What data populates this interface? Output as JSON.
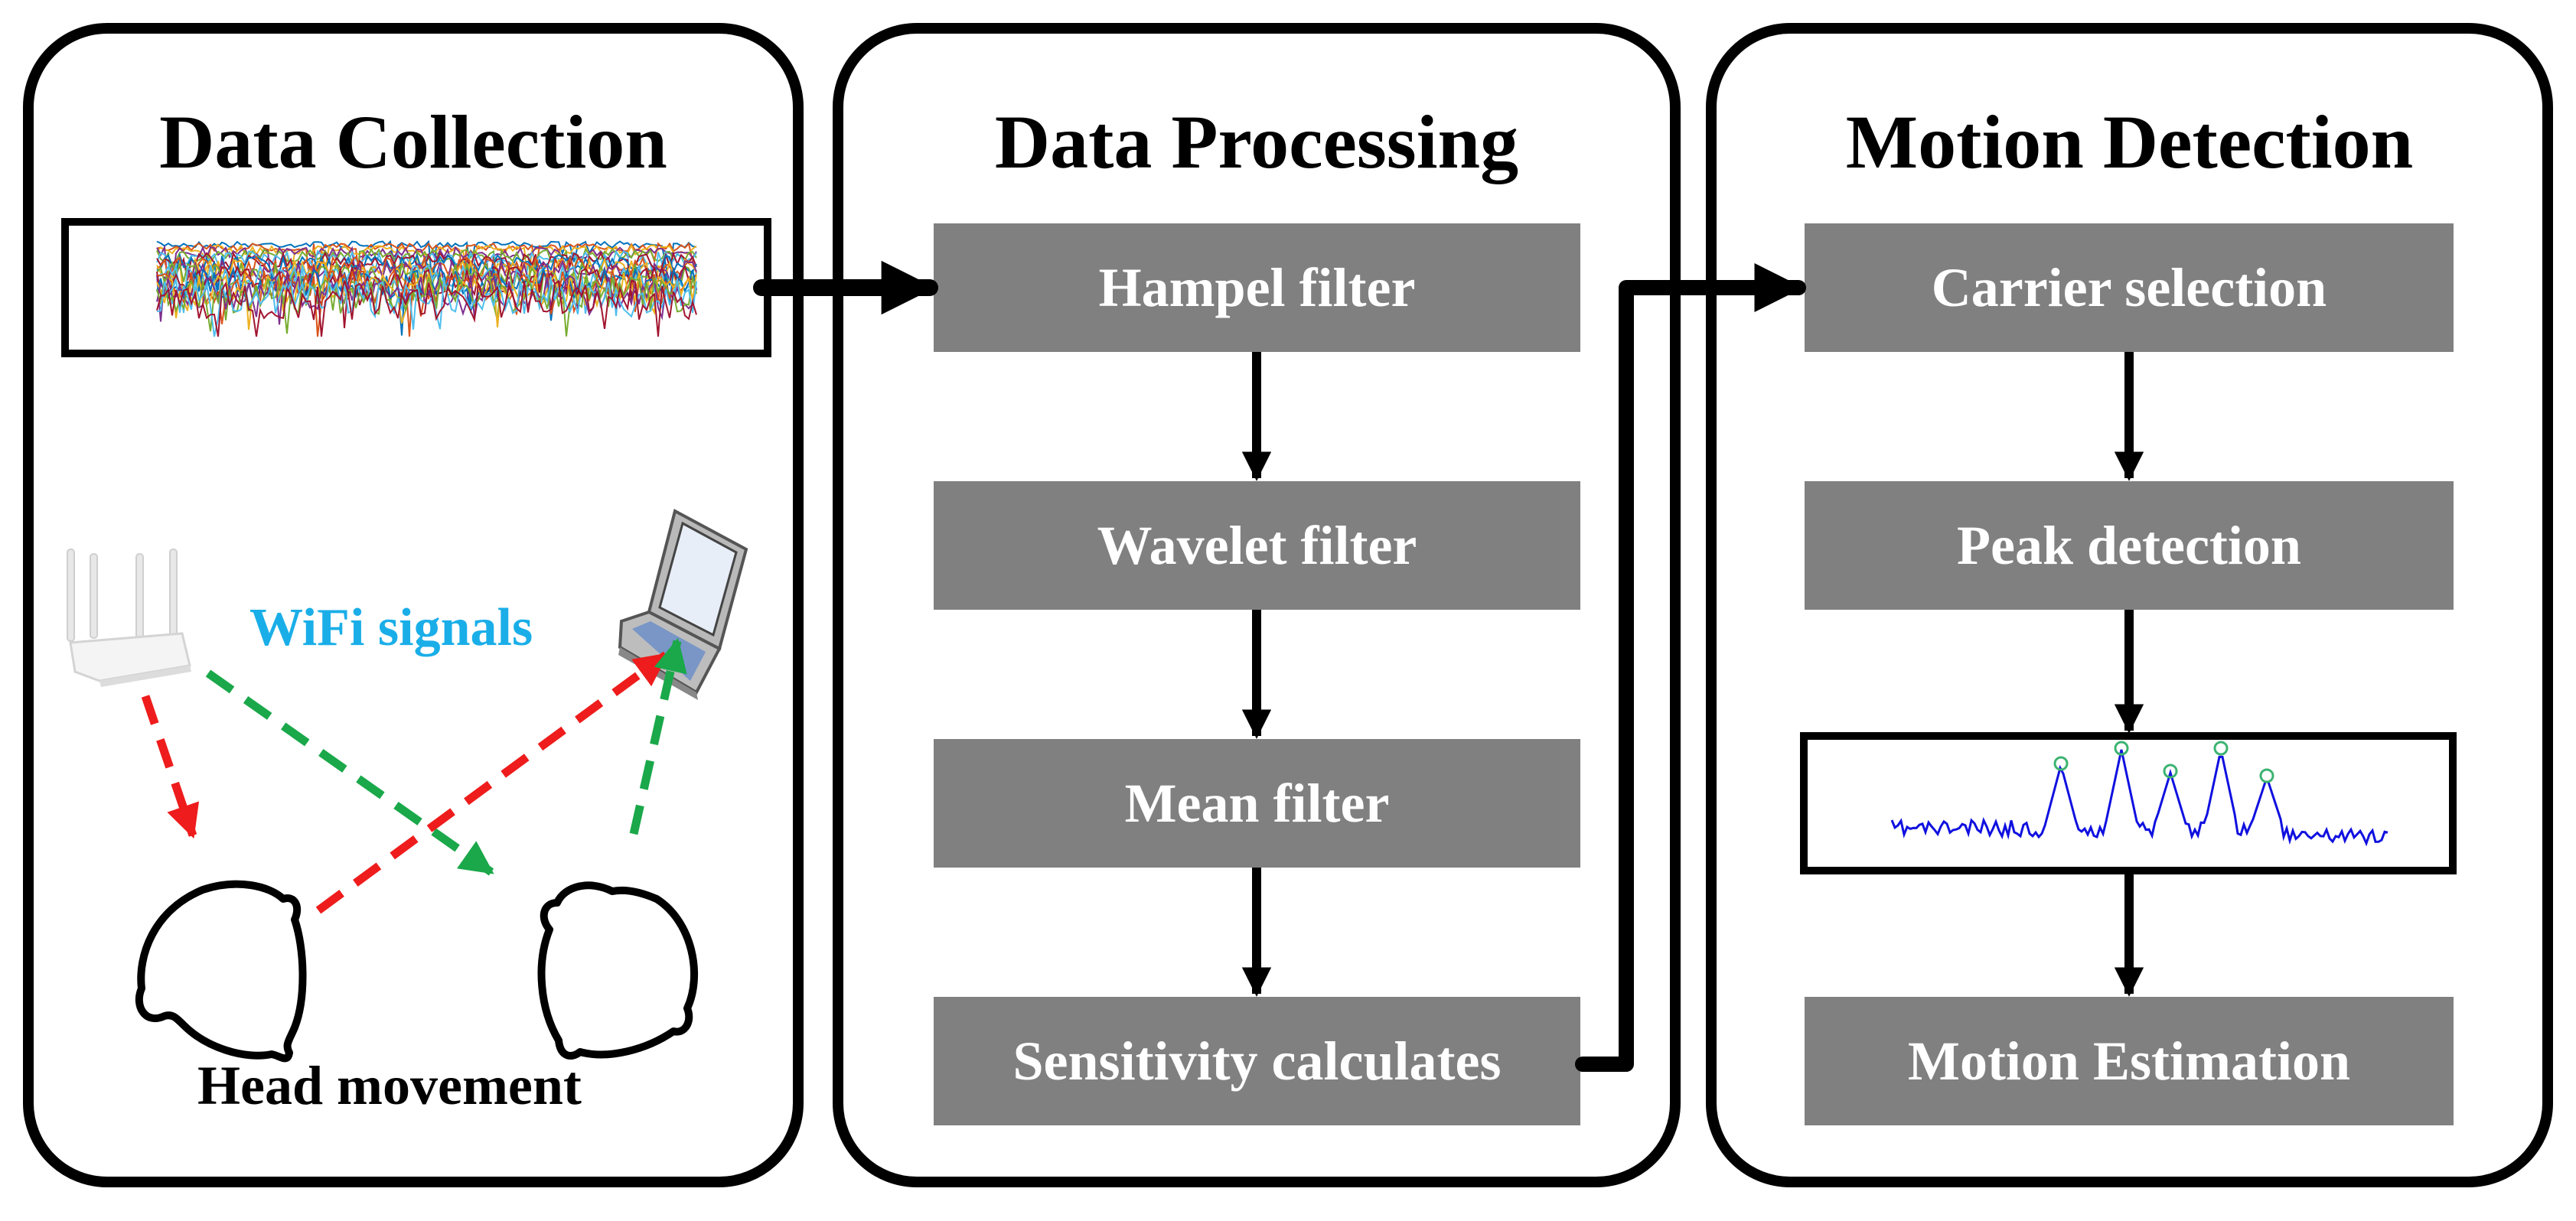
{
  "panels": [
    {
      "title": "Data Collection",
      "wifi_label": "WiFi signals",
      "caption": "Head movement",
      "wifi_color": "#1AAEE8",
      "icons": [
        "csi-waveform-plot",
        "wifi-router-icon",
        "laptop-icon",
        "head-icon",
        "head-icon"
      ]
    },
    {
      "title": "Data Processing",
      "steps": [
        "Hampel filter",
        "Wavelet filter",
        "Mean filter",
        "Sensitivity calculates"
      ]
    },
    {
      "title": "Motion Detection",
      "steps": [
        "Carrier selection",
        "Peak detection",
        "Motion Estimation"
      ],
      "peak_plot": {
        "line_color": "#1010E0",
        "marker_color": "#3CB371",
        "peak_count": 5
      }
    }
  ],
  "colors": {
    "step_box": "#808080",
    "step_text": "#FFFFFF",
    "signal_red": "#EE1C1C",
    "signal_green": "#1AA84A"
  }
}
